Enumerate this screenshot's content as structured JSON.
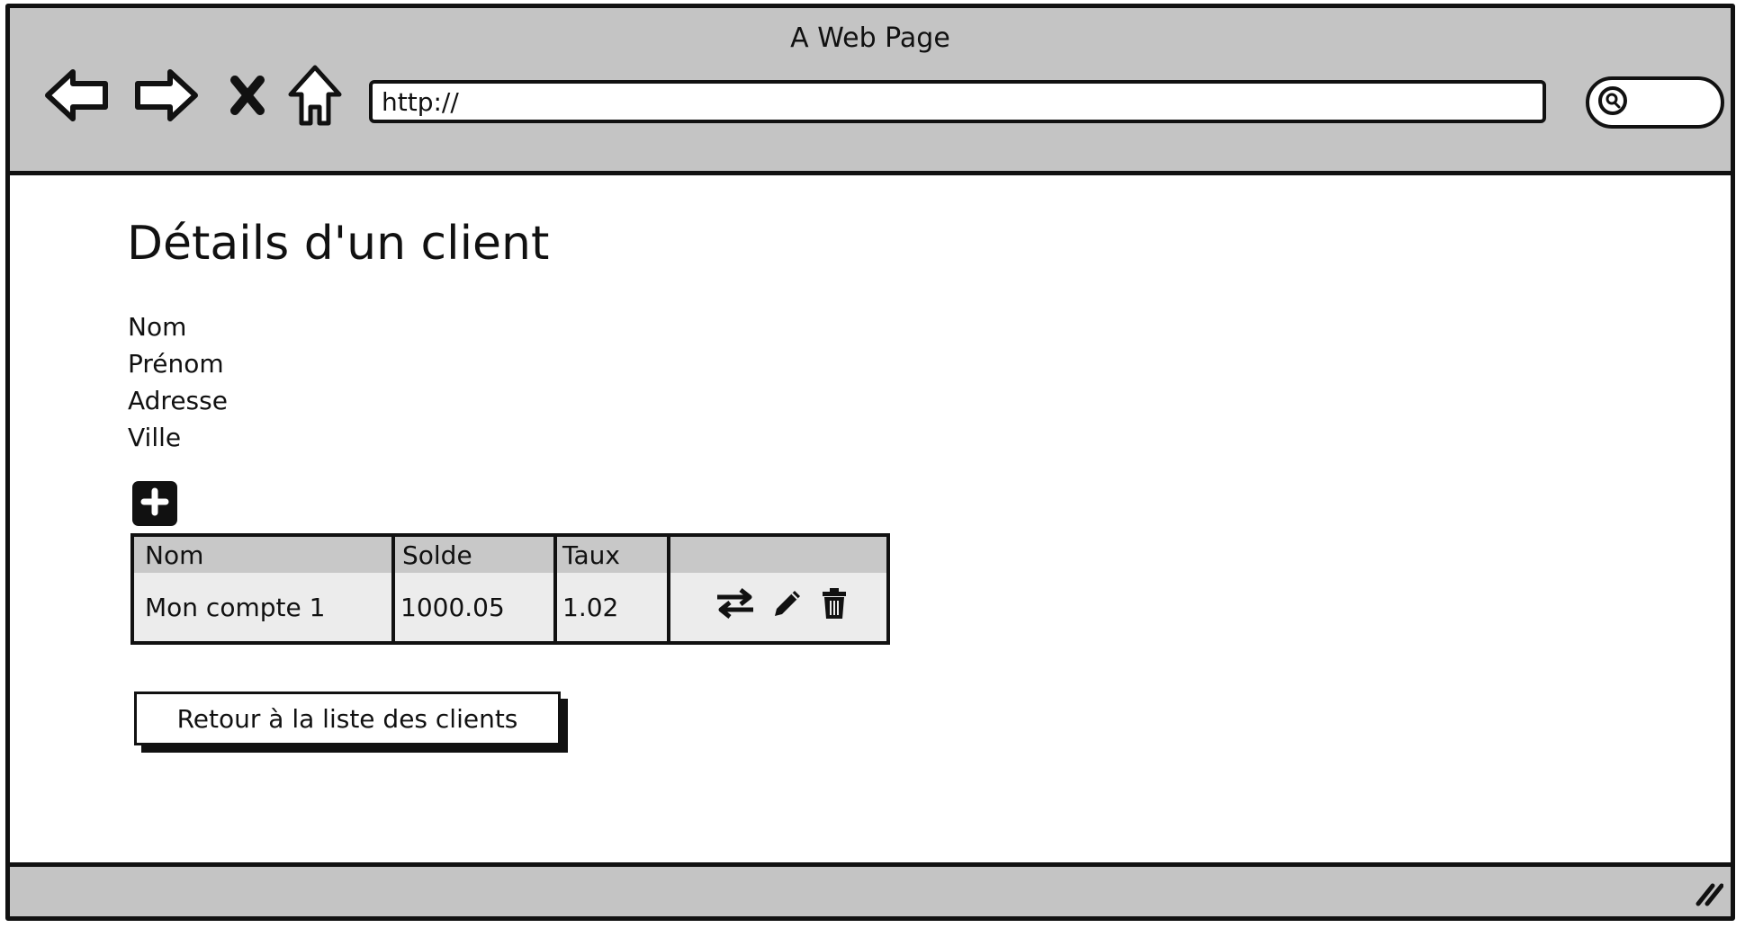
{
  "window": {
    "title": "A Web Page"
  },
  "toolbar": {
    "back_icon": "back-arrow-icon",
    "forward_icon": "forward-arrow-icon",
    "stop_icon": "close-icon",
    "home_icon": "home-icon",
    "url_value": "http://",
    "search_icon": "search-icon"
  },
  "main": {
    "page_title": "Détails d'un client",
    "fields": [
      "Nom",
      "Prénom",
      "Adresse",
      "Ville"
    ],
    "add_icon": "plus-icon",
    "table": {
      "headers": [
        "Nom",
        "Solde",
        "Taux",
        ""
      ],
      "rows": [
        {
          "nom": "Mon compte 1",
          "solde": "1000.05",
          "taux": "1.02",
          "actions": [
            "transfer-icon",
            "pencil-icon",
            "trash-icon"
          ]
        }
      ]
    },
    "back_button_label": "Retour à la liste des clients"
  },
  "colors": {
    "chrome": "#c4c4c4",
    "header_row": "#c8c8c8",
    "table_row": "#ececec",
    "ink": "#111111"
  }
}
